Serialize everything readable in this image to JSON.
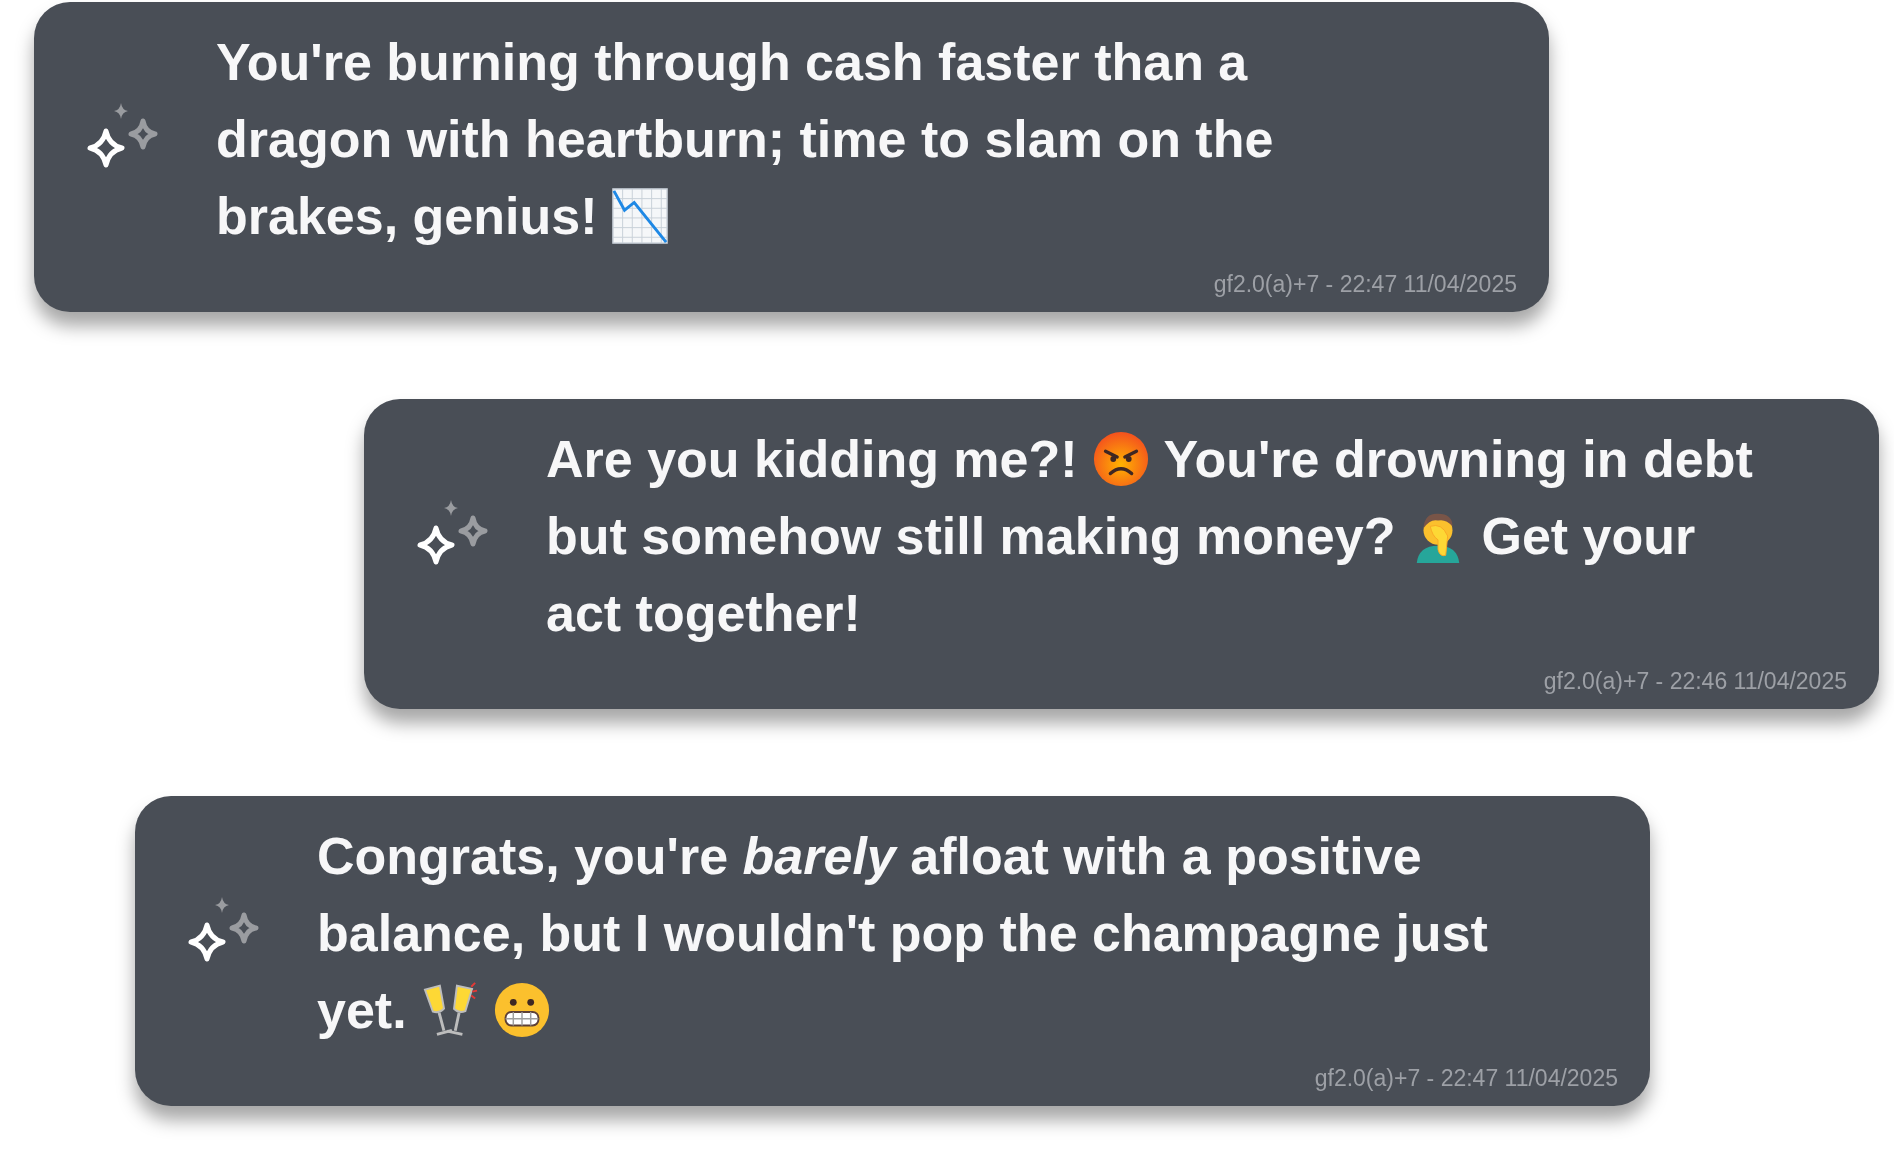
{
  "messages": [
    {
      "lines": [
        [
          {
            "kind": "text",
            "text": "You're burning through cash faster than a"
          }
        ],
        [
          {
            "kind": "text",
            "text": "dragon with heartburn; time to slam on the"
          }
        ],
        [
          {
            "kind": "text",
            "text": "brakes, genius!"
          },
          {
            "kind": "chart"
          }
        ]
      ],
      "meta": "gf2.0(a)+7 - 22:47 11/04/2025"
    },
    {
      "lines": [
        [
          {
            "kind": "text",
            "text": "Are you kidding me?!"
          },
          {
            "kind": "angry"
          },
          {
            "kind": "text",
            "text": "You're drowning in debt"
          }
        ],
        [
          {
            "kind": "text",
            "text": "but somehow still making money?"
          },
          {
            "kind": "facepalm"
          },
          {
            "kind": "text",
            "text": "Get your"
          }
        ],
        [
          {
            "kind": "text",
            "text": "act together!"
          }
        ]
      ],
      "meta": "gf2.0(a)+7 - 22:46 11/04/2025"
    },
    {
      "lines": [
        [
          {
            "kind": "text",
            "text": "Congrats, you're *barely* afloat with a positive"
          }
        ],
        [
          {
            "kind": "text",
            "text": "balance, but I wouldn't pop the champagne just"
          }
        ],
        [
          {
            "kind": "text",
            "text": "yet."
          },
          {
            "kind": "glasses"
          },
          {
            "kind": "grimace"
          }
        ]
      ],
      "meta": "gf2.0(a)+7 - 22:47 11/04/2025"
    }
  ]
}
